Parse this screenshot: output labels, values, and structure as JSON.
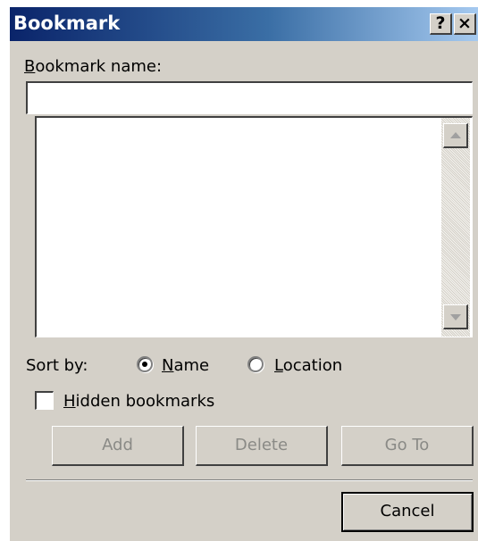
{
  "window": {
    "title": "Bookmark",
    "help_button": "?",
    "close_button": "×"
  },
  "bookmark_name": {
    "label_access_key": "B",
    "label_rest": "ookmark name:",
    "value": ""
  },
  "bookmark_list": {
    "items": []
  },
  "sort": {
    "label": "Sort by:",
    "options": [
      {
        "access_key": "N",
        "rest": "ame",
        "selected": true
      },
      {
        "access_key": "L",
        "rest": "ocation",
        "selected": false
      }
    ]
  },
  "hidden_bookmarks": {
    "access_key": "H",
    "rest": "idden bookmarks",
    "checked": false
  },
  "buttons": {
    "add": "Add",
    "delete": "Delete",
    "go_to": "Go To",
    "cancel": "Cancel"
  },
  "colors": {
    "dialog_bg": "#d4d0c8",
    "titlebar_start": "#0a246a",
    "titlebar_end": "#a6caf0",
    "disabled_text": "#8a8a86"
  }
}
